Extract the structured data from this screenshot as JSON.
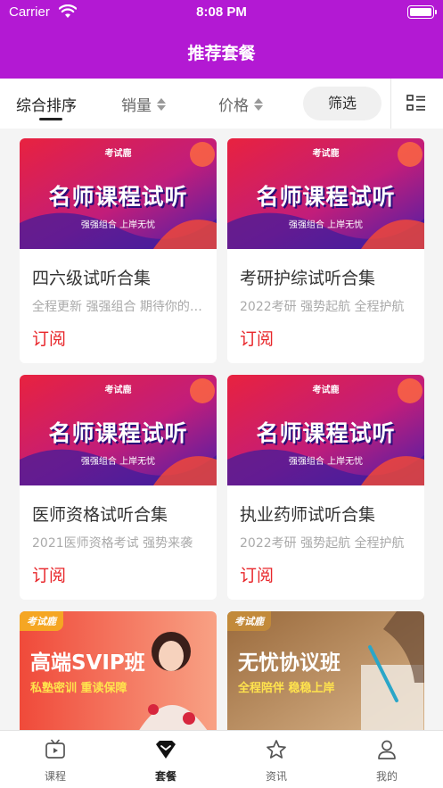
{
  "status_bar": {
    "carrier": "Carrier",
    "time": "8:08 PM"
  },
  "nav": {
    "title": "推荐套餐"
  },
  "filters": {
    "sort_default": "综合排序",
    "sales": "销量",
    "price": "价格",
    "filter_button": "筛选"
  },
  "banner": {
    "badge": "考试鹿",
    "headline": "名师课程试听",
    "tagline": "强强组合 上岸无忧"
  },
  "cards": [
    {
      "title": "四六级试听合集",
      "subtitle": "全程更新 强强组合 期待你的加入",
      "action": "订阅"
    },
    {
      "title": "考研护综试听合集",
      "subtitle": "2022考研 强势起航 全程护航",
      "action": "订阅"
    },
    {
      "title": "医师资格试听合集",
      "subtitle": "2021医师资格考试 强势来袭",
      "action": "订阅"
    },
    {
      "title": "执业药师试听合集",
      "subtitle": "2022考研 强势起航 全程护航",
      "action": "订阅"
    }
  ],
  "promos": [
    {
      "badge": "考试鹿",
      "headline": "高端SVIP班",
      "tagline": "私塾密训 重读保障"
    },
    {
      "badge": "考试鹿",
      "headline": "无忧协议班",
      "tagline": "全程陪伴 稳稳上岸"
    }
  ],
  "tabs": [
    {
      "label": "课程",
      "icon": "tv-icon",
      "active": false
    },
    {
      "label": "套餐",
      "icon": "diamond-icon",
      "active": true
    },
    {
      "label": "资讯",
      "icon": "star-icon",
      "active": false
    },
    {
      "label": "我的",
      "icon": "person-icon",
      "active": false
    }
  ],
  "colors": {
    "header": "#b319d3",
    "accent": "#e8262a",
    "promo_yellow": "#ffe34d"
  }
}
